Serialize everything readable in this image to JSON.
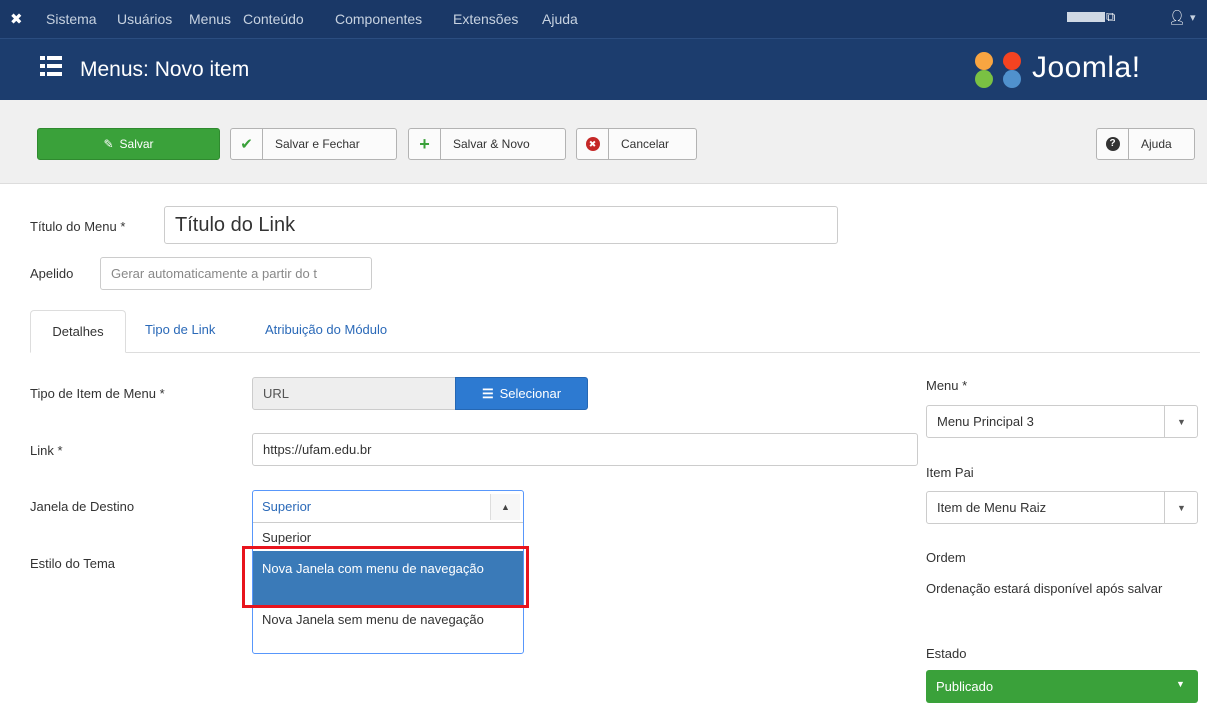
{
  "topnav": {
    "menu": [
      "Sistema",
      "Usuários",
      "Menus",
      "Conteúdo",
      "Componentes",
      "Extensões",
      "Ajuda"
    ]
  },
  "header": {
    "title": "Menus: Novo item",
    "logo_text": "Joomla!"
  },
  "toolbar": {
    "save": "Salvar",
    "save_close": "Salvar e Fechar",
    "save_new": "Salvar & Novo",
    "cancel": "Cancelar",
    "help": "Ajuda"
  },
  "form": {
    "title_label": "Título do Menu *",
    "title_value": "Título do Link",
    "alias_label": "Apelido",
    "alias_placeholder": "Gerar automaticamente a partir do t",
    "tabs": [
      "Detalhes",
      "Tipo de Link",
      "Atribuição do Módulo"
    ],
    "type_label": "Tipo de Item de Menu *",
    "type_value": "URL",
    "select_button": "Selecionar",
    "link_label": "Link *",
    "link_value": "https://ufam.edu.br",
    "target_label": "Janela de Destino",
    "target_selected": "Superior",
    "target_options": [
      "Superior",
      "Nova Janela com menu de navegação",
      "Nova Janela sem menu de navegação"
    ],
    "style_label": "Estilo do Tema"
  },
  "sidebar": {
    "menu_label": "Menu *",
    "menu_value": "Menu Principal 3",
    "parent_label": "Item Pai",
    "parent_value": "Item de Menu Raiz",
    "order_label": "Ordem",
    "order_text": "Ordenação estará disponível após salvar",
    "state_label": "Estado",
    "state_value": "Publicado"
  },
  "colors": {
    "navy": "#1a3867",
    "green": "#3aa13a",
    "blue": "#2d7ad1",
    "highlight": "#e8141d"
  }
}
